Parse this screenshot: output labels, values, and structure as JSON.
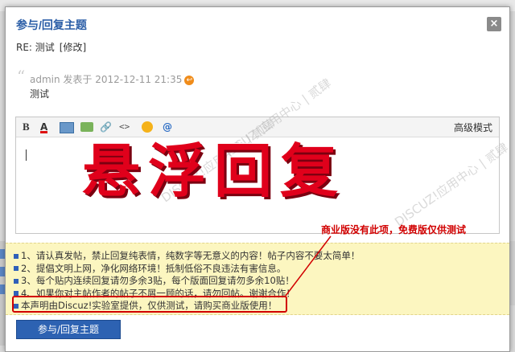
{
  "dialog": {
    "title": "参与/回复主题",
    "close_label": "×",
    "re_subject": "RE: 测试",
    "edit_link": "[修改]"
  },
  "quote": {
    "mark": "“",
    "author_line": "admin 发表于 2012-12-11 21:35",
    "arrow_glyph": "↩",
    "text": "测试"
  },
  "editor": {
    "bold_label": "B",
    "color_label": "A",
    "link_label": "🔗",
    "code_label": "<>",
    "at_label": "@",
    "advanced_label": "高级模式"
  },
  "overlay": {
    "big_text": "悬浮回复",
    "watermark": "DISCUZ!应用中心 | 贰肆",
    "tip": "商业版没有此项，免费版仅供测试"
  },
  "notice": {
    "items": [
      "1、请认真发帖，禁止回复纯表情，纯数字等无意义的内容！帖子内容不要太简单！",
      "2、提倡文明上网，净化网络环境！抵制低俗不良违法有害信息。",
      "3、每个贴内连续回复请勿多余3贴，每个版面回复请勿多余10贴！",
      "4、如果你对主帖作者的帖子不屑一顾的话，请勿回帖。谢谢合作！",
      "本声明由Discuz!实验室提供，仅供测试，请购买商业版使用！"
    ]
  },
  "submit_label": "参与/回复主题",
  "colors": {
    "accent": "#2d62b2",
    "highlight_red": "#d10000",
    "notice_bg": "#fcf6c0"
  }
}
